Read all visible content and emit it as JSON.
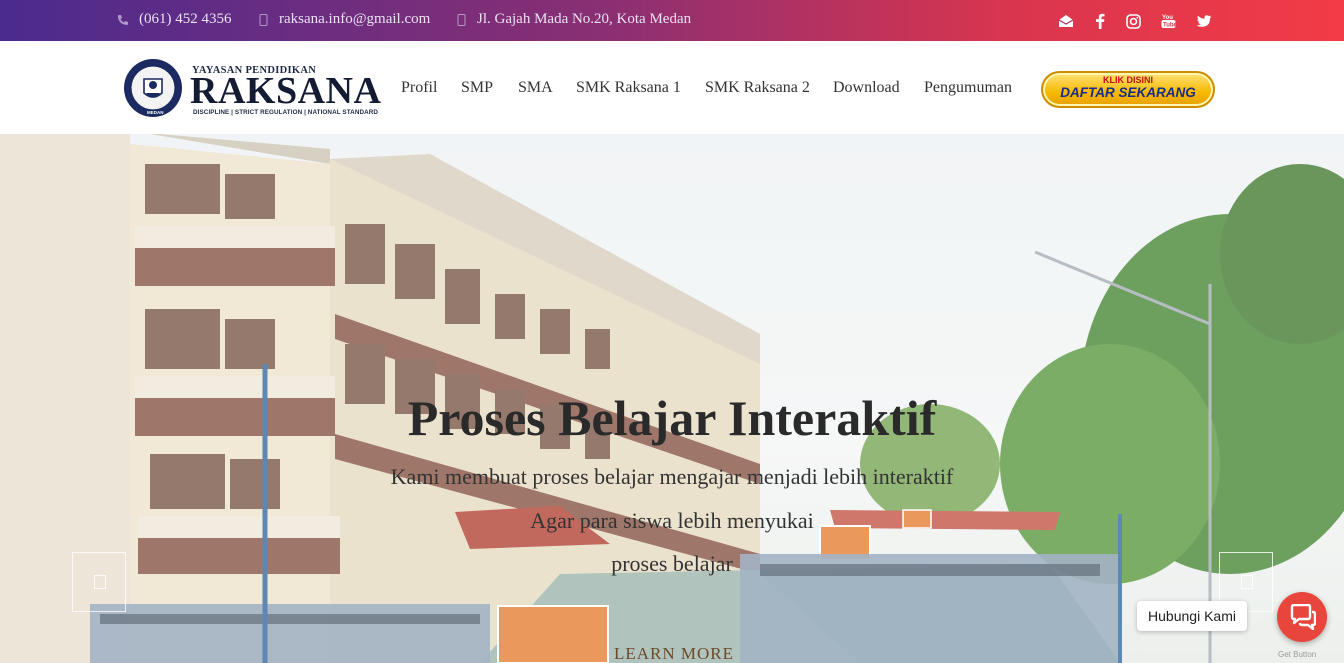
{
  "topbar": {
    "phone": "(061) 452 4356",
    "email": "raksana.info@gmail.com",
    "address": "Jl. Gajah Mada No.20, Kota Medan",
    "social": [
      "envelope-open-icon",
      "facebook-icon",
      "instagram-icon",
      "youtube-icon",
      "twitter-icon"
    ]
  },
  "logo": {
    "top": "YAYASAN PENDIDIKAN",
    "main": "RAKSANA",
    "sub": "DISCIPLINE | STRICT REGULATION | NATIONAL STANDARD"
  },
  "nav": {
    "items": [
      "Profil",
      "SMP",
      "SMA",
      "SMK Raksana 1",
      "SMK Raksana 2",
      "Download",
      "Pengumuman"
    ]
  },
  "cta": {
    "line1": "KLIK DISINI",
    "line2": "DAFTAR SEKARANG"
  },
  "slider": {
    "title": "Proses Belajar Interaktif",
    "lines": [
      "Kami membuat proses belajar mengajar menjadi lebih interaktif",
      "Agar para siswa lebih menyukai",
      "proses belajar"
    ],
    "button": "LEARN MORE"
  },
  "chat": {
    "label": "Hubungi Kami",
    "credit": "Get Button"
  },
  "colors": {
    "topbar_start": "#4b2b8e",
    "topbar_end": "#f23b46",
    "chat_button": "#e8453c"
  }
}
